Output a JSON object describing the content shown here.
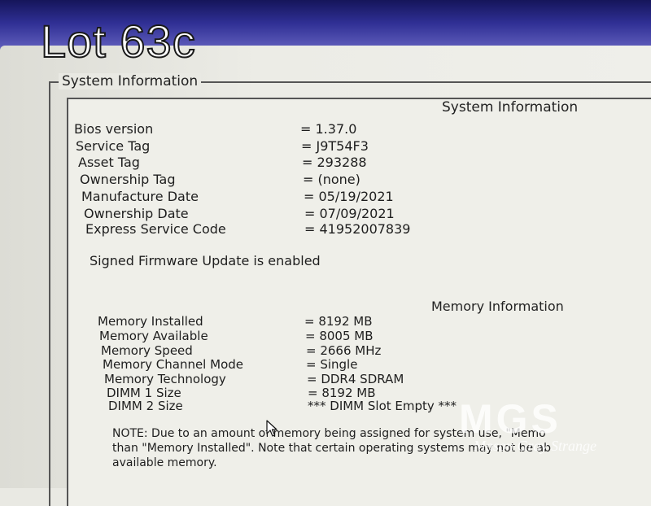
{
  "photo_label": "Lot 63c",
  "outer_title": "System Information",
  "panel_heading": "System Information",
  "system_info": [
    {
      "label": "Bios version",
      "value": "= 1.37.0"
    },
    {
      "label": "Service Tag",
      "value": "= J9T54F3"
    },
    {
      "label": "Asset Tag",
      "value": "= 293288"
    },
    {
      "label": "Ownership Tag",
      "value": "= (none)"
    },
    {
      "label": "Manufacture Date",
      "value": "= 05/19/2021"
    },
    {
      "label": "Ownership Date",
      "value": "= 07/09/2021"
    },
    {
      "label": "Express Service Code",
      "value": "= 41952007839"
    }
  ],
  "firmware_status": "Signed Firmware Update is enabled",
  "memory_heading": "Memory Information",
  "memory_info": [
    {
      "label": "Memory Installed",
      "value": "= 8192 MB"
    },
    {
      "label": "Memory Available",
      "value": "= 8005 MB"
    },
    {
      "label": "Memory Speed",
      "value": "= 2666 MHz"
    },
    {
      "label": "Memory Channel Mode",
      "value": "= Single"
    },
    {
      "label": "Memory Technology",
      "value": "= DDR4 SDRAM"
    },
    {
      "label": "DIMM 1 Size",
      "value": "= 8192 MB"
    },
    {
      "label": "DIMM 2 Size",
      "value": "*** DIMM Slot Empty ***"
    }
  ],
  "note_lines": [
    "NOTE: Due to an amount of memory being assigned for system use, \"Memo",
    "than \"Memory Installed\". Note that certain operating systems may not be ab",
    "available memory."
  ],
  "watermark": "MGS",
  "watermark_sub": "Mason Gray Strange"
}
